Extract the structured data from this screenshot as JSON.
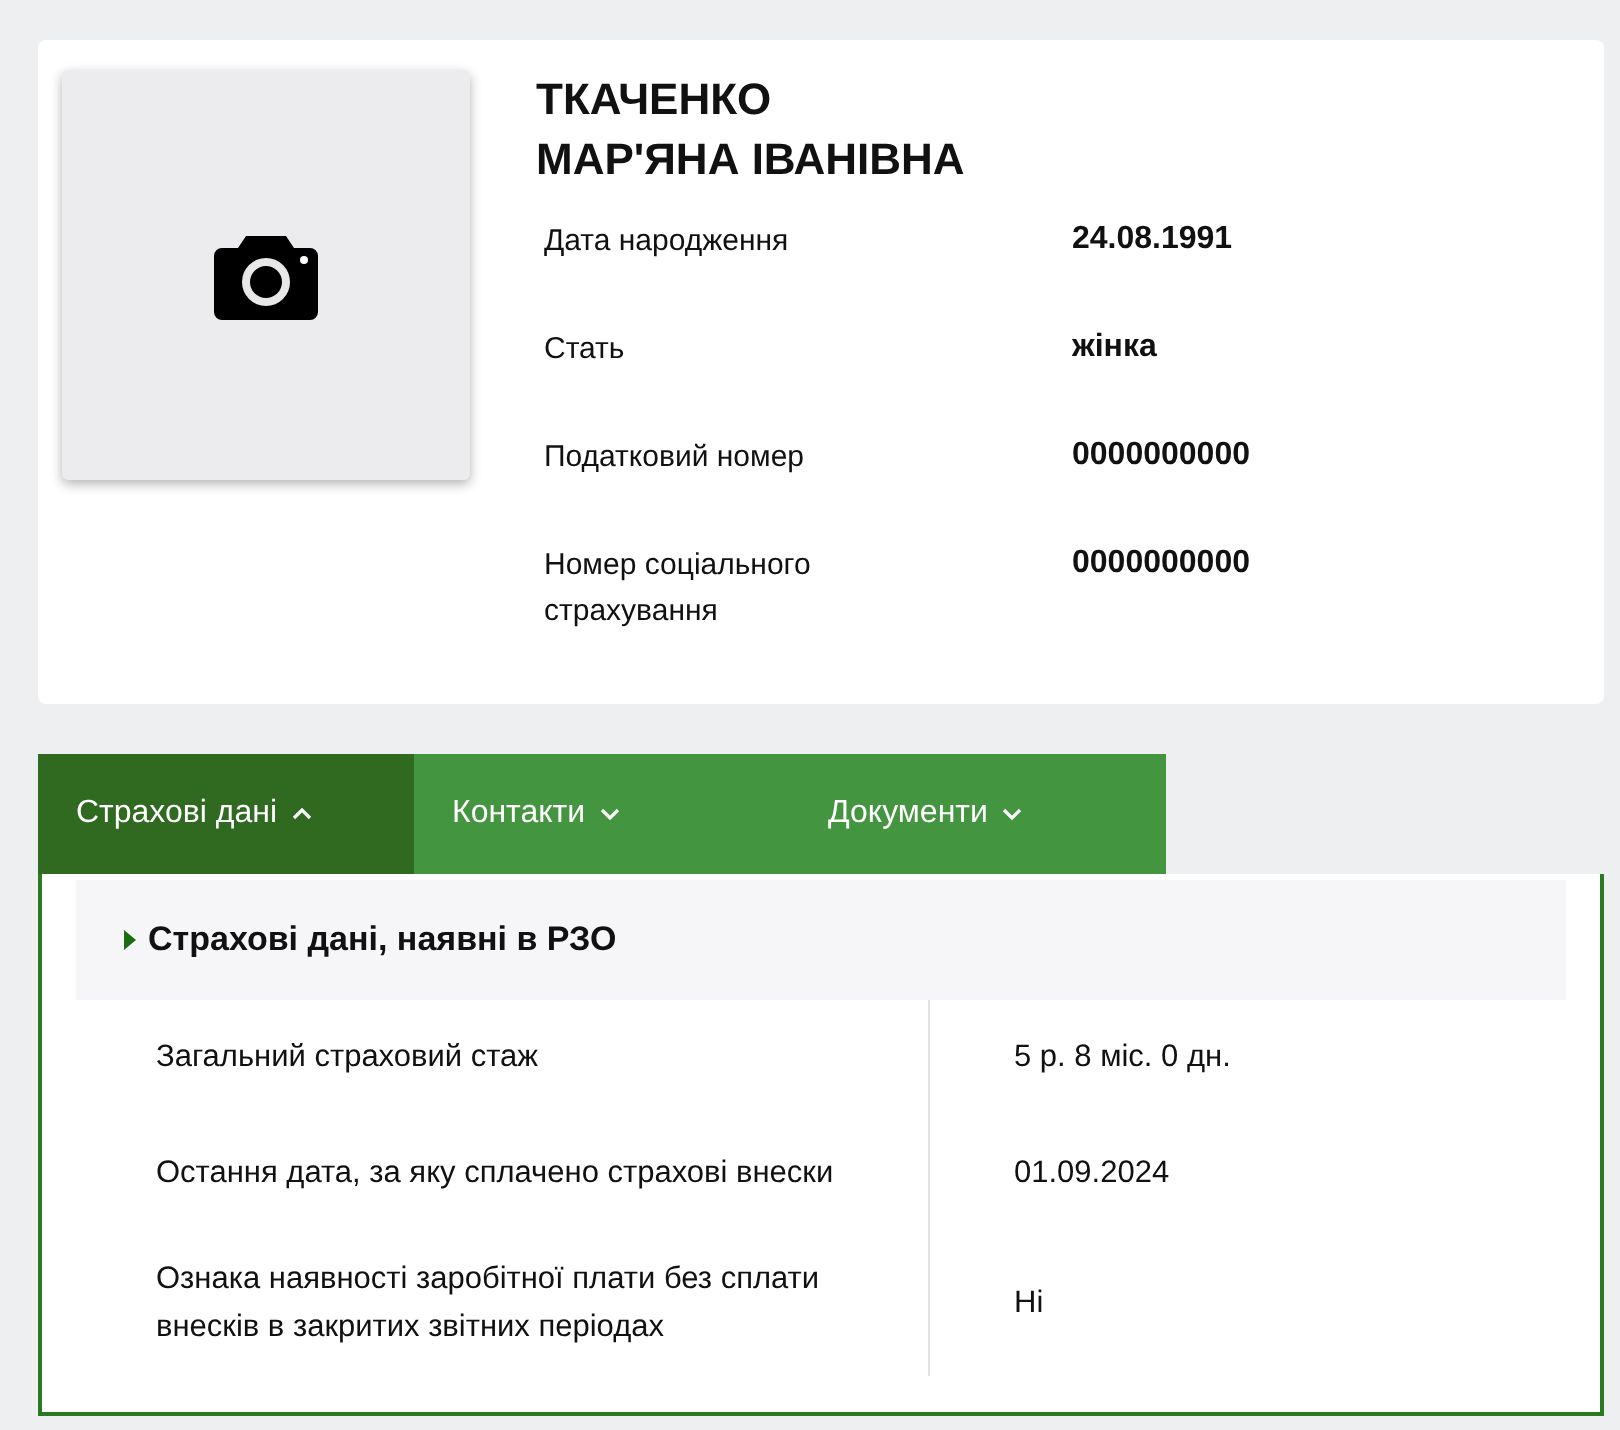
{
  "person": {
    "surname": "ТКАЧЕНКО",
    "given_names": "МАР'ЯНА ІВАНІВНА",
    "fields": [
      {
        "label": "Дата народження",
        "value": "24.08.1991"
      },
      {
        "label": "Стать",
        "value": "жінка"
      },
      {
        "label": "Податковий номер",
        "value": "0000000000"
      },
      {
        "label": "Номер соціального страхування",
        "value": "0000000000"
      }
    ]
  },
  "tabs": [
    {
      "label": "Страхові дані",
      "selected": true,
      "expanded": true
    },
    {
      "label": "Контакти",
      "selected": false,
      "expanded": false
    },
    {
      "label": "Документи",
      "selected": false,
      "expanded": false
    }
  ],
  "section": {
    "title": "Страхові дані, наявні в РЗО",
    "rows": [
      {
        "label": "Загальний страховий стаж",
        "value": "5 р. 8 міс. 0 дн."
      },
      {
        "label": "Остання дата, за яку сплачено страхові внески",
        "value": "01.09.2024"
      },
      {
        "label": "Ознака наявності заробітної плати без сплати внесків в закритих звітних періодах",
        "value": "Ні"
      }
    ]
  }
}
